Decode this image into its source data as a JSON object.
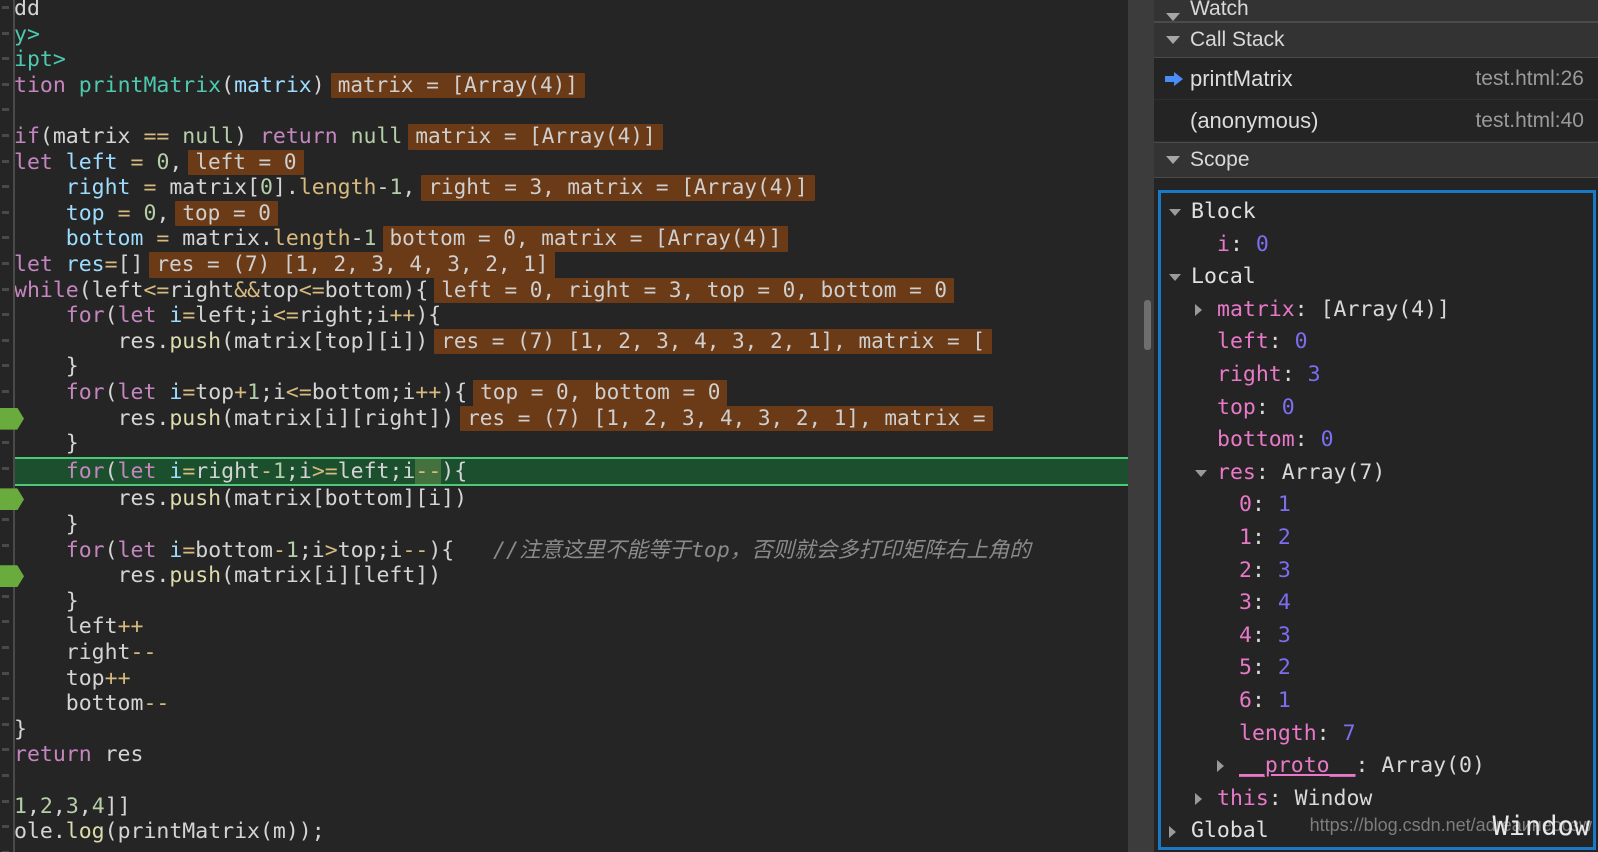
{
  "editor": {
    "code_lines": [
      {
        "indent": 0,
        "truncated_top": true,
        "tokens": [
          {
            "t": "dd",
            "c": "pl"
          }
        ]
      },
      {
        "indent": 0,
        "tokens": [
          {
            "t": "y>",
            "c": "tag"
          }
        ]
      },
      {
        "indent": 0,
        "tokens": [
          {
            "t": "ipt>",
            "c": "tag"
          }
        ]
      },
      {
        "indent": 0,
        "tokens": [
          {
            "t": "tion ",
            "c": "kw"
          },
          {
            "t": "printMatrix",
            "c": "fn"
          },
          {
            "t": "(",
            "c": "pl"
          },
          {
            "t": "matrix",
            "c": "id"
          },
          {
            "t": ")",
            "c": "pl"
          }
        ],
        "hint": "matrix = [Array(4)]"
      },
      {
        "indent": 0,
        "tokens": []
      },
      {
        "indent": 0,
        "tokens": [
          {
            "t": "if",
            "c": "kw"
          },
          {
            "t": "(matrix ",
            "c": "pl"
          },
          {
            "t": "==",
            "c": "op"
          },
          {
            "t": " ",
            "c": "pl"
          },
          {
            "t": "null",
            "c": "num"
          },
          {
            "t": ") ",
            "c": "pl"
          },
          {
            "t": "return",
            "c": "kw"
          },
          {
            "t": " ",
            "c": "pl"
          },
          {
            "t": "null",
            "c": "num"
          }
        ],
        "hint": "matrix = [Array(4)]"
      },
      {
        "indent": 0,
        "tokens": [
          {
            "t": "let",
            "c": "kw"
          },
          {
            "t": " ",
            "c": "pl"
          },
          {
            "t": "left",
            "c": "id"
          },
          {
            "t": " ",
            "c": "pl"
          },
          {
            "t": "=",
            "c": "op"
          },
          {
            "t": " ",
            "c": "pl"
          },
          {
            "t": "0",
            "c": "num"
          },
          {
            "t": ",",
            "c": "pl"
          }
        ],
        "hint": "left = 0"
      },
      {
        "indent": 1,
        "tokens": [
          {
            "t": "right",
            "c": "id"
          },
          {
            "t": " ",
            "c": "pl"
          },
          {
            "t": "=",
            "c": "op"
          },
          {
            "t": " matrix[",
            "c": "pl"
          },
          {
            "t": "0",
            "c": "num"
          },
          {
            "t": "].",
            "c": "pl"
          },
          {
            "t": "length",
            "c": "op"
          },
          {
            "t": "-",
            "c": "pl"
          },
          {
            "t": "1",
            "c": "num"
          },
          {
            "t": ",",
            "c": "pl"
          }
        ],
        "hint": "right = 3, matrix = [Array(4)]"
      },
      {
        "indent": 1,
        "tokens": [
          {
            "t": "top",
            "c": "id"
          },
          {
            "t": " ",
            "c": "pl"
          },
          {
            "t": "=",
            "c": "op"
          },
          {
            "t": " ",
            "c": "pl"
          },
          {
            "t": "0",
            "c": "num"
          },
          {
            "t": ",",
            "c": "pl"
          }
        ],
        "hint": "top = 0"
      },
      {
        "indent": 1,
        "tokens": [
          {
            "t": "bottom",
            "c": "id"
          },
          {
            "t": " ",
            "c": "pl"
          },
          {
            "t": "=",
            "c": "op"
          },
          {
            "t": " matrix.",
            "c": "pl"
          },
          {
            "t": "length",
            "c": "op"
          },
          {
            "t": "-",
            "c": "pl"
          },
          {
            "t": "1",
            "c": "num"
          }
        ],
        "hint": "bottom = 0, matrix = [Array(4)]"
      },
      {
        "indent": 0,
        "tokens": [
          {
            "t": "let",
            "c": "kw"
          },
          {
            "t": " ",
            "c": "pl"
          },
          {
            "t": "res",
            "c": "id"
          },
          {
            "t": "=",
            "c": "op"
          },
          {
            "t": "[]",
            "c": "pl"
          }
        ],
        "hint": "res = (7) [1, 2, 3, 4, 3, 2, 1]"
      },
      {
        "indent": 0,
        "tokens": [
          {
            "t": "while",
            "c": "kw"
          },
          {
            "t": "(left",
            "c": "pl"
          },
          {
            "t": "<=",
            "c": "op"
          },
          {
            "t": "right",
            "c": "pl"
          },
          {
            "t": "&&",
            "c": "op"
          },
          {
            "t": "top",
            "c": "pl"
          },
          {
            "t": "<=",
            "c": "op"
          },
          {
            "t": "bottom){",
            "c": "pl"
          }
        ],
        "hint": "left = 0, right = 3, top = 0, bottom = 0"
      },
      {
        "indent": 1,
        "tokens": [
          {
            "t": "for",
            "c": "kw"
          },
          {
            "t": "(",
            "c": "pl"
          },
          {
            "t": "let",
            "c": "kw"
          },
          {
            "t": " ",
            "c": "pl"
          },
          {
            "t": "i",
            "c": "id"
          },
          {
            "t": "=",
            "c": "op"
          },
          {
            "t": "left;i",
            "c": "pl"
          },
          {
            "t": "<=",
            "c": "op"
          },
          {
            "t": "right;i",
            "c": "pl"
          },
          {
            "t": "++",
            "c": "op"
          },
          {
            "t": "){",
            "c": "pl"
          }
        ]
      },
      {
        "indent": 2,
        "tokens": [
          {
            "t": "res.",
            "c": "pl"
          },
          {
            "t": "push",
            "c": "meth"
          },
          {
            "t": "(matrix[top][i])",
            "c": "pl"
          }
        ],
        "hint": "res = (7) [1, 2, 3, 4, 3, 2, 1], matrix = ["
      },
      {
        "indent": 1,
        "tokens": [
          {
            "t": "}",
            "c": "pl"
          }
        ]
      },
      {
        "indent": 1,
        "tokens": [
          {
            "t": "for",
            "c": "kw"
          },
          {
            "t": "(",
            "c": "pl"
          },
          {
            "t": "let",
            "c": "kw"
          },
          {
            "t": " ",
            "c": "pl"
          },
          {
            "t": "i",
            "c": "id"
          },
          {
            "t": "=",
            "c": "op"
          },
          {
            "t": "top",
            "c": "pl"
          },
          {
            "t": "+",
            "c": "op"
          },
          {
            "t": "1",
            "c": "num"
          },
          {
            "t": ";i",
            "c": "pl"
          },
          {
            "t": "<=",
            "c": "op"
          },
          {
            "t": "bottom;i",
            "c": "pl"
          },
          {
            "t": "++",
            "c": "op"
          },
          {
            "t": "){",
            "c": "pl"
          }
        ],
        "hint": "top = 0, bottom = 0"
      },
      {
        "indent": 2,
        "marker": true,
        "tokens": [
          {
            "t": "res.",
            "c": "pl"
          },
          {
            "t": "push",
            "c": "meth"
          },
          {
            "t": "(matrix[i][right])",
            "c": "pl"
          }
        ],
        "hint": "res = (7) [1, 2, 3, 4, 3, 2, 1], matrix ="
      },
      {
        "indent": 1,
        "tokens": [
          {
            "t": "}",
            "c": "pl"
          }
        ]
      },
      {
        "indent": 1,
        "exec": true,
        "tokens": [
          {
            "t": "for",
            "c": "kw"
          },
          {
            "t": "(",
            "c": "pl"
          },
          {
            "t": "let",
            "c": "kw"
          },
          {
            "t": " ",
            "c": "pl"
          },
          {
            "t": "i",
            "c": "id"
          },
          {
            "t": "=",
            "c": "op"
          },
          {
            "t": "right",
            "c": "pl"
          },
          {
            "t": "-",
            "c": "op"
          },
          {
            "t": "1",
            "c": "num"
          },
          {
            "t": ";i",
            "c": "pl"
          },
          {
            "t": ">=",
            "c": "op"
          },
          {
            "t": "left;i",
            "c": "pl"
          },
          {
            "t": "--",
            "c": "sel op"
          },
          {
            "t": "){",
            "c": "pl"
          }
        ]
      },
      {
        "indent": 2,
        "marker": true,
        "tokens": [
          {
            "t": "res.",
            "c": "pl"
          },
          {
            "t": "push",
            "c": "meth"
          },
          {
            "t": "(matrix[bottom][i])",
            "c": "pl"
          }
        ]
      },
      {
        "indent": 1,
        "tokens": [
          {
            "t": "}",
            "c": "pl"
          }
        ]
      },
      {
        "indent": 1,
        "tokens": [
          {
            "t": "for",
            "c": "kw"
          },
          {
            "t": "(",
            "c": "pl"
          },
          {
            "t": "let",
            "c": "kw"
          },
          {
            "t": " ",
            "c": "pl"
          },
          {
            "t": "i",
            "c": "id"
          },
          {
            "t": "=",
            "c": "op"
          },
          {
            "t": "bottom",
            "c": "pl"
          },
          {
            "t": "-",
            "c": "op"
          },
          {
            "t": "1",
            "c": "num"
          },
          {
            "t": ";i",
            "c": "pl"
          },
          {
            "t": ">",
            "c": "op"
          },
          {
            "t": "top;i",
            "c": "pl"
          },
          {
            "t": "--",
            "c": "op"
          },
          {
            "t": "){",
            "c": "pl"
          },
          {
            "t": "   //注意这里不能等于top，否则就会多打印矩阵右上角的",
            "c": "cmt"
          }
        ]
      },
      {
        "indent": 2,
        "marker": true,
        "tokens": [
          {
            "t": "res.",
            "c": "pl"
          },
          {
            "t": "push",
            "c": "meth"
          },
          {
            "t": "(matrix[i][left])",
            "c": "pl"
          }
        ]
      },
      {
        "indent": 1,
        "tokens": [
          {
            "t": "}",
            "c": "pl"
          }
        ]
      },
      {
        "indent": 1,
        "tokens": [
          {
            "t": "left",
            "c": "pl"
          },
          {
            "t": "++",
            "c": "op"
          }
        ]
      },
      {
        "indent": 1,
        "tokens": [
          {
            "t": "right",
            "c": "pl"
          },
          {
            "t": "--",
            "c": "op"
          }
        ]
      },
      {
        "indent": 1,
        "tokens": [
          {
            "t": "top",
            "c": "pl"
          },
          {
            "t": "++",
            "c": "op"
          }
        ]
      },
      {
        "indent": 1,
        "tokens": [
          {
            "t": "bottom",
            "c": "pl"
          },
          {
            "t": "--",
            "c": "op"
          }
        ]
      },
      {
        "indent": 0,
        "tokens": [
          {
            "t": "}",
            "c": "pl"
          }
        ]
      },
      {
        "indent": 0,
        "tokens": [
          {
            "t": "return",
            "c": "kw"
          },
          {
            "t": " res",
            "c": "pl"
          }
        ]
      },
      {
        "indent": 0,
        "tokens": []
      },
      {
        "indent": 0,
        "tokens": [
          {
            "t": "1",
            "c": "num"
          },
          {
            "t": ",",
            "c": "pl"
          },
          {
            "t": "2",
            "c": "num"
          },
          {
            "t": ",",
            "c": "pl"
          },
          {
            "t": "3",
            "c": "num"
          },
          {
            "t": ",",
            "c": "pl"
          },
          {
            "t": "4",
            "c": "num"
          },
          {
            "t": "]]",
            "c": "pl"
          }
        ]
      },
      {
        "indent": 0,
        "tokens": [
          {
            "t": "ole.",
            "c": "pl"
          },
          {
            "t": "log",
            "c": "meth"
          },
          {
            "t": "(printMatrix(m));",
            "c": "pl"
          }
        ]
      }
    ]
  },
  "sidebar": {
    "watch": {
      "label": "Watch"
    },
    "call_stack": {
      "label": "Call Stack",
      "frames": [
        {
          "name": "printMatrix",
          "location": "test.html:26",
          "current": true
        },
        {
          "name": "(anonymous)",
          "location": "test.html:40",
          "current": false
        }
      ]
    },
    "scope": {
      "label": "Scope",
      "nodes": [
        {
          "depth": 0,
          "twist": "down",
          "name": "Block",
          "sep": "",
          "value": "",
          "nameClass": "tname-scope",
          "valueClass": "tval"
        },
        {
          "depth": 1,
          "twist": "none",
          "name": "i",
          "sep": ": ",
          "value": "0",
          "nameClass": "tprop",
          "valueClass": "tnum"
        },
        {
          "depth": 0,
          "twist": "down",
          "name": "Local",
          "sep": "",
          "value": "",
          "nameClass": "tname-scope",
          "valueClass": "tval"
        },
        {
          "depth": 1,
          "twist": "right",
          "name": "matrix",
          "sep": ": ",
          "value": "[Array(4)]",
          "nameClass": "tprop",
          "valueClass": "tval"
        },
        {
          "depth": 1,
          "twist": "none",
          "name": "left",
          "sep": ": ",
          "value": "0",
          "nameClass": "tprop",
          "valueClass": "tnum"
        },
        {
          "depth": 1,
          "twist": "none",
          "name": "right",
          "sep": ": ",
          "value": "3",
          "nameClass": "tprop",
          "valueClass": "tnum"
        },
        {
          "depth": 1,
          "twist": "none",
          "name": "top",
          "sep": ": ",
          "value": "0",
          "nameClass": "tprop",
          "valueClass": "tnum"
        },
        {
          "depth": 1,
          "twist": "none",
          "name": "bottom",
          "sep": ": ",
          "value": "0",
          "nameClass": "tprop",
          "valueClass": "tnum"
        },
        {
          "depth": 1,
          "twist": "down",
          "name": "res",
          "sep": ": ",
          "value": "Array(7)",
          "nameClass": "tprop",
          "valueClass": "tval"
        },
        {
          "depth": 2,
          "twist": "none",
          "name": "0",
          "sep": ": ",
          "value": "1",
          "nameClass": "tprop",
          "valueClass": "tnum"
        },
        {
          "depth": 2,
          "twist": "none",
          "name": "1",
          "sep": ": ",
          "value": "2",
          "nameClass": "tprop",
          "valueClass": "tnum"
        },
        {
          "depth": 2,
          "twist": "none",
          "name": "2",
          "sep": ": ",
          "value": "3",
          "nameClass": "tprop",
          "valueClass": "tnum"
        },
        {
          "depth": 2,
          "twist": "none",
          "name": "3",
          "sep": ": ",
          "value": "4",
          "nameClass": "tprop",
          "valueClass": "tnum"
        },
        {
          "depth": 2,
          "twist": "none",
          "name": "4",
          "sep": ": ",
          "value": "3",
          "nameClass": "tprop",
          "valueClass": "tnum"
        },
        {
          "depth": 2,
          "twist": "none",
          "name": "5",
          "sep": ": ",
          "value": "2",
          "nameClass": "tprop",
          "valueClass": "tnum"
        },
        {
          "depth": 2,
          "twist": "none",
          "name": "6",
          "sep": ": ",
          "value": "1",
          "nameClass": "tprop",
          "valueClass": "tnum"
        },
        {
          "depth": 2,
          "twist": "none",
          "name": "length",
          "sep": ": ",
          "value": "7",
          "nameClass": "tprop",
          "valueClass": "tnum"
        },
        {
          "depth": 2,
          "twist": "right",
          "name": "__proto__",
          "sep": ": ",
          "value": "Array(0)",
          "nameClass": "tproto",
          "valueClass": "tval"
        },
        {
          "depth": 1,
          "twist": "right",
          "name": "this",
          "sep": ": ",
          "value": "Window",
          "nameClass": "tprop",
          "valueClass": "tval"
        },
        {
          "depth": 0,
          "twist": "right",
          "name": "Global",
          "sep": "",
          "value": "",
          "nameClass": "tname-scope",
          "valueClass": "tval"
        }
      ],
      "global_value": "Window"
    }
  },
  "watermark": {
    "text": "https://blog.csdn.net/adreаинеосзw"
  },
  "colors": {
    "editor_bg": "#252526",
    "sidebar_bg": "#242424",
    "exec_line_bg": "#1b4f2e",
    "exec_line_border": "#4ec97a",
    "hint_bg": "#6b3a16",
    "focus_border": "#1a79c4",
    "current_frame_arrow": "#4a8df8",
    "marker_green": "#6aab3e"
  }
}
